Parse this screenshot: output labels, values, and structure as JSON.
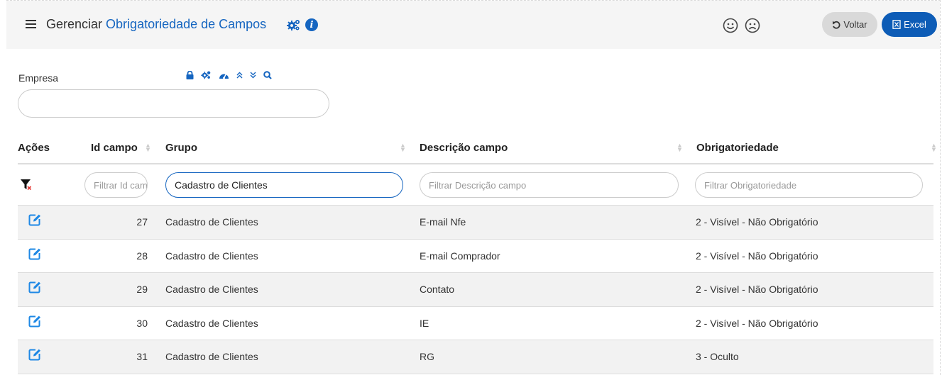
{
  "header": {
    "title_prefix": "Gerenciar",
    "title_accent": "Obrigatoriedade de Campos",
    "btn_voltar": "Voltar",
    "btn_excel": "Excel",
    "icons": [
      "menu-icon",
      "cogs-icon",
      "info-icon",
      "happy-face-icon",
      "sad-face-icon",
      "undo-icon",
      "file-excel-icon"
    ]
  },
  "empresa": {
    "label": "Empresa",
    "value": "",
    "tools": [
      "lock-icon",
      "cogs-icon",
      "tachometer-icon",
      "chevrons-up-icon",
      "chevrons-down-icon",
      "search-icon"
    ]
  },
  "table": {
    "columns": [
      "Ações",
      "Id campo",
      "Grupo",
      "Descrição campo",
      "Obrigatoriedade"
    ],
    "filters": {
      "id_placeholder": "Filtrar Id campo",
      "grupo_value": "Cadastro de Clientes",
      "descricao_placeholder": "Filtrar Descrição campo",
      "obrigatoriedade_placeholder": "Filtrar Obrigatoriedade"
    },
    "rows": [
      {
        "id": "27",
        "grupo": "Cadastro de Clientes",
        "descricao": "E-mail Nfe",
        "obrigatoriedade": "2 - Visível - Não Obrigatório"
      },
      {
        "id": "28",
        "grupo": "Cadastro de Clientes",
        "descricao": "E-mail Comprador",
        "obrigatoriedade": "2 - Visível - Não Obrigatório"
      },
      {
        "id": "29",
        "grupo": "Cadastro de Clientes",
        "descricao": "Contato",
        "obrigatoriedade": "2 - Visível - Não Obrigatório"
      },
      {
        "id": "30",
        "grupo": "Cadastro de Clientes",
        "descricao": "IE",
        "obrigatoriedade": "2 - Visível - Não Obrigatório"
      },
      {
        "id": "31",
        "grupo": "Cadastro de Clientes",
        "descricao": "RG",
        "obrigatoriedade": "3 - Oculto"
      }
    ]
  },
  "colors": {
    "accent": "#1565c0",
    "excel_button": "#0d5cb6",
    "voltar_button": "#d9d9d9",
    "header_bg": "#f5f5f5",
    "clear_filter": "#e53935"
  }
}
